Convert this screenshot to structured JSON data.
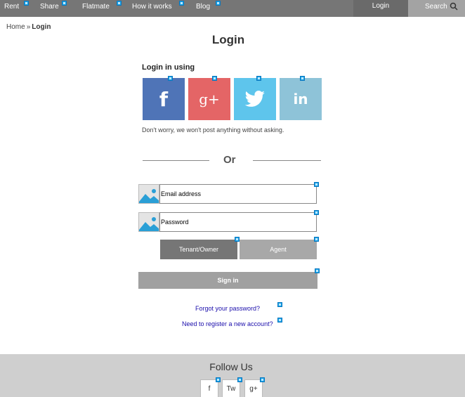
{
  "nav": {
    "rent": "Rent",
    "share": "Share",
    "flatmate": "Flatmate",
    "how_it_works": "How it works",
    "blog": "Blog",
    "login": "Login",
    "search": "Search"
  },
  "breadcrumb": {
    "home": "Home",
    "separator": "»",
    "current": "Login"
  },
  "page_title": "Login",
  "social": {
    "heading": "Login in using",
    "buttons": [
      {
        "name": "facebook",
        "glyph": "f",
        "color": "#4f74b7"
      },
      {
        "name": "google-plus",
        "glyph": "g+",
        "color": "#e46566"
      },
      {
        "name": "twitter",
        "glyph": "",
        "color": "#5ec5ec"
      },
      {
        "name": "linkedin",
        "glyph": "in",
        "color": "#8ec3d8"
      }
    ],
    "note": "Don't worry, we won't post anything without asking."
  },
  "divider_text": "Or",
  "form": {
    "email_placeholder": "Email address",
    "password_placeholder": "Password",
    "role_tenant": "Tenant/Owner",
    "role_agent": "Agent",
    "sign_in": "Sign in"
  },
  "links": {
    "forgot": "Forgot your password?",
    "register": "Need to register a new account?"
  },
  "footer": {
    "title": "Follow Us",
    "buttons": [
      "f",
      "Tw",
      "g+"
    ]
  },
  "colors": {
    "nav_bg": "#767676",
    "link": "#1a0dab",
    "footer_bg": "#cfcfcf"
  }
}
